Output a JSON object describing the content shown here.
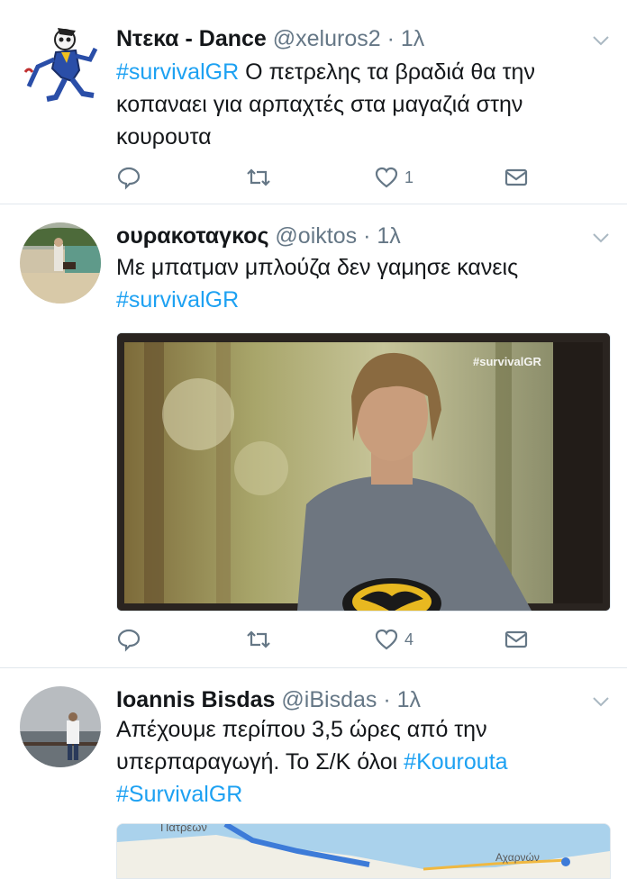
{
  "tweets": [
    {
      "name": "Ντεκα - Dance",
      "handle": "@xeluros2",
      "dot": "·",
      "time": "1λ",
      "text_hashtag": "#survivalGR",
      "text_rest": " Ο πετρελης τα βραδιά θα την κοπαναει για αρπαχτές στα μαγαζιά στην κουρουτα",
      "reply_count": "",
      "retweet_count": "",
      "like_count": "1"
    },
    {
      "name": "ουρακοταγκος",
      "handle": "@oiktos",
      "dot": "·",
      "time": "1λ",
      "text_plain": "Με μπατμαν μπλούζα δεν γαμησε κανεις",
      "text_hashtag": "#survivalGR",
      "media_watermark": "#survivalGR",
      "reply_count": "",
      "retweet_count": "",
      "like_count": "4"
    },
    {
      "name": "Ioannis Bisdas",
      "handle": "@iBisdas",
      "dot": "·",
      "time": "1λ",
      "text_plain": "Απέχουμε περίπου 3,5 ώρες από την υπερπαραγωγή. Το Σ/Κ όλοι ",
      "text_hashtag1": "#Kourouta",
      "text_hashtag2": "#SurvivalGR",
      "map_label1": "Πατρέων",
      "map_label2": "Αχαρνών"
    }
  ],
  "colors": {
    "accent": "#1da1f2",
    "muted": "#657786",
    "border": "#e1e8ed"
  }
}
